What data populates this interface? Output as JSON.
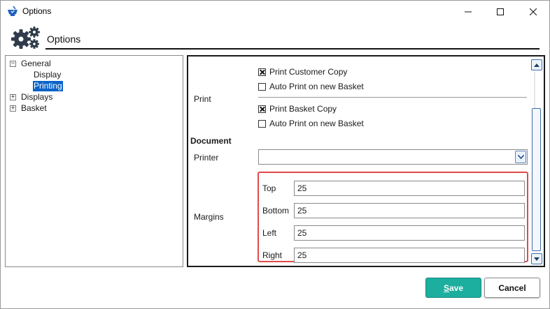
{
  "window": {
    "title": "Options",
    "minimize_icon": "minimize-icon",
    "maximize_icon": "maximize-icon",
    "close_icon": "close-icon"
  },
  "header": {
    "title": "Options",
    "icon": "gears-icon"
  },
  "tree": {
    "items": [
      {
        "label": "General",
        "toggle": "−",
        "expanded": true
      },
      {
        "label": "Display"
      },
      {
        "label": "Printing",
        "selected": true
      },
      {
        "label": "Displays",
        "toggle": "+"
      },
      {
        "label": "Basket",
        "toggle": "+"
      }
    ]
  },
  "print_section": {
    "label": "Print",
    "print_customer_copy": {
      "label": "Print Customer Copy",
      "checked": true
    },
    "auto_print_1": {
      "label": "Auto Print on new Basket",
      "checked": false
    },
    "print_basket_copy": {
      "label": "Print Basket Copy",
      "checked": true
    },
    "auto_print_2": {
      "label": "Auto Print on new Basket",
      "checked": false
    }
  },
  "document_section": {
    "heading": "Document",
    "printer_label": "Printer",
    "printer_value": "",
    "margins_label": "Margins",
    "margins": [
      {
        "label": "Top",
        "value": "25"
      },
      {
        "label": "Bottom",
        "value": "25"
      },
      {
        "label": "Left",
        "value": "25"
      },
      {
        "label": "Right",
        "value": "25"
      }
    ],
    "highlight_color": "#e24a4a"
  },
  "buttons": {
    "save": {
      "prefix": "",
      "mnemonic": "S",
      "rest": "ave",
      "color": "#1cae9e"
    },
    "cancel": {
      "label": "Cancel"
    }
  }
}
